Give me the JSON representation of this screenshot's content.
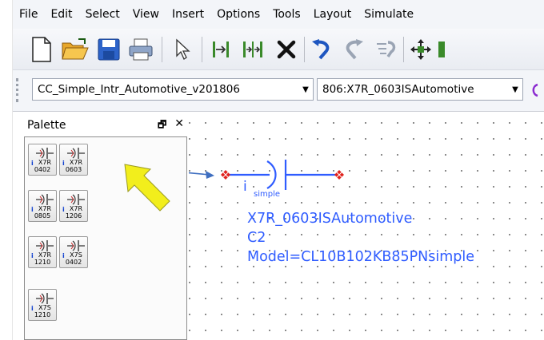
{
  "menu": [
    "File",
    "Edit",
    "Select",
    "View",
    "Insert",
    "Options",
    "Tools",
    "Layout",
    "Simulate"
  ],
  "toolbar1": {
    "buttons": [
      "new-file",
      "open-folder",
      "save",
      "print",
      "select-pointer",
      "insert-pin",
      "insert-pins",
      "delete",
      "undo",
      "redo",
      "repeat",
      "move"
    ]
  },
  "toolbar2": {
    "library_value": "CC_Simple_Intr_Automotive_v201806",
    "component_value": "806:X7R_0603ISAutomotive"
  },
  "palette": {
    "title": "Palette",
    "float_glyph": "🗗",
    "close_glyph": "✕",
    "items": [
      {
        "line1": "X7R",
        "line2": "0402"
      },
      {
        "line1": "X7R",
        "line2": "0603"
      },
      {
        "line1": "X7R",
        "line2": "0805"
      },
      {
        "line1": "X7R",
        "line2": "1206"
      },
      {
        "line1": "X7R",
        "line2": "1210"
      },
      {
        "line1": "X7S",
        "line2": "0402"
      },
      {
        "line1": "X7S",
        "line2": "1210"
      }
    ]
  },
  "component": {
    "i_label": "i",
    "simple_label": "simple",
    "part_name": "X7R_0603ISAutomotive",
    "ref": "C2",
    "model": "Model=CL10B102KB85PNsimple"
  },
  "colors": {
    "component_blue": "#2f5cff",
    "pin_red": "#e0221c",
    "arrow_blue": "#3f6fc0",
    "pointer_yellow": "#f2ee1c"
  }
}
